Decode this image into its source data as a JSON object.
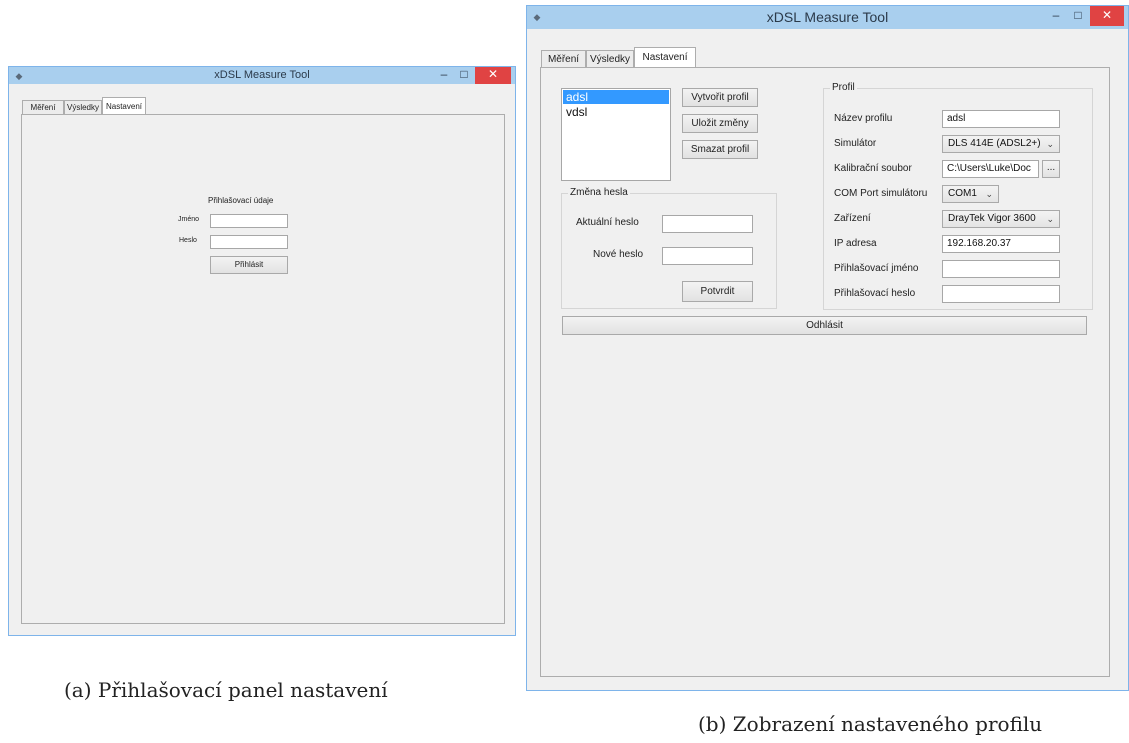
{
  "window_a": {
    "title": "xDSL Measure Tool",
    "controls": {
      "minimize": "–",
      "maximize": "□",
      "close": "✕"
    },
    "tabs": [
      "Měření",
      "Výsledky",
      "Nastavení"
    ],
    "login": {
      "heading": "Přihlašovací údaje",
      "name_label": "Jméno",
      "name_value": "",
      "password_label": "Heslo",
      "password_value": "",
      "login_button": "Přihlásit"
    }
  },
  "caption_a": "(a) Přihlašovací panel nastavení",
  "window_b": {
    "title": "xDSL Measure Tool",
    "controls": {
      "minimize": "–",
      "maximize": "□",
      "close": "✕"
    },
    "tabs": [
      "Měření",
      "Výsledky",
      "Nastavení"
    ],
    "profiles": [
      "adsl",
      "vdsl"
    ],
    "selected_profile": "adsl",
    "buttons": {
      "create": "Vytvořit profil",
      "save": "Uložit změny",
      "delete": "Smazat profil"
    },
    "password_change": {
      "title": "Změna hesla",
      "current_label": "Aktuální heslo",
      "current_value": "",
      "new_label": "Nové heslo",
      "new_value": "",
      "confirm_button": "Potvrdit"
    },
    "profile": {
      "title": "Profil",
      "name_label": "Název profilu",
      "name_value": "adsl",
      "simulator_label": "Simulátor",
      "simulator_value": "DLS 414E (ADSL2+)",
      "calibration_label": "Kalibrační soubor",
      "calibration_value": "C:\\Users\\Luke\\Doc",
      "browse_button": "...",
      "com_label": "COM Port simulátoru",
      "com_value": "COM1",
      "device_label": "Zařízení",
      "device_value": "DrayTek Vigor 3600",
      "ip_label": "IP adresa",
      "ip_value": "192.168.20.37",
      "login_name_label": "Přihlašovací jméno",
      "login_name_value": "",
      "login_password_label": "Přihlašovací heslo",
      "login_password_value": ""
    },
    "logout_button": "Odhlásit"
  },
  "caption_b": "(b) Zobrazení nastaveného profilu",
  "colors": {
    "titlebar": "#a9cfee",
    "border": "#7eb4ea",
    "close": "#e04343",
    "selection": "#3399ff"
  }
}
